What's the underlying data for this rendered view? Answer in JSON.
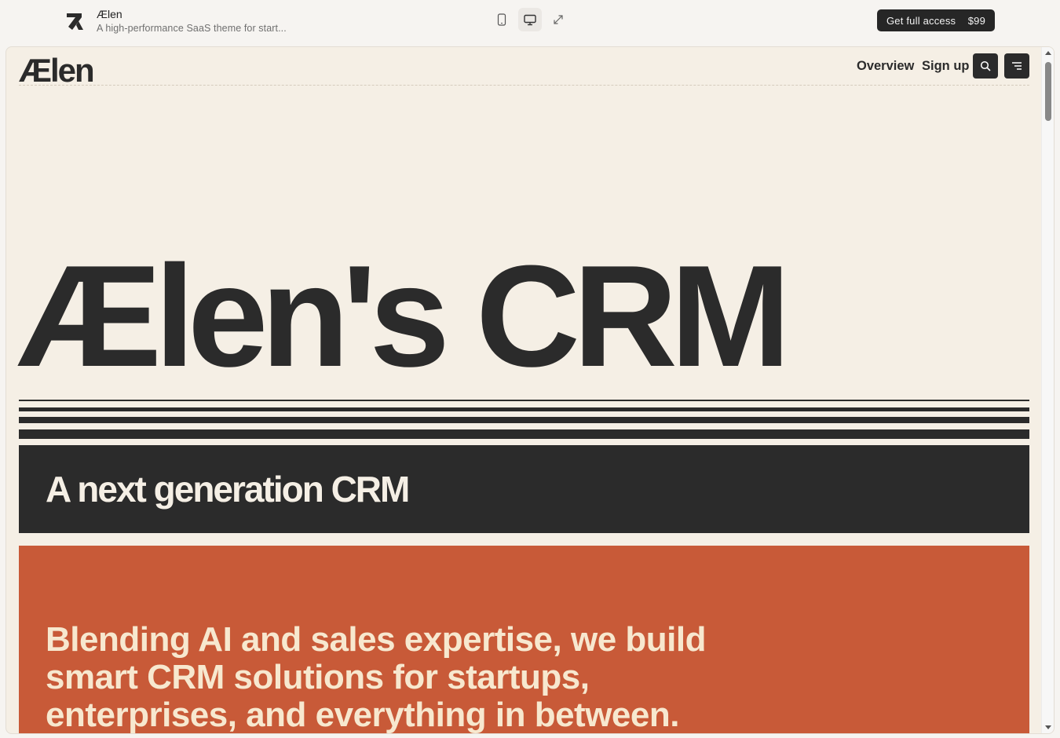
{
  "preview_bar": {
    "title": "Ælen",
    "subtitle": "A high-performance SaaS theme for start...",
    "cta_label": "Get full access",
    "cta_price": "$99",
    "view_modes": [
      "mobile",
      "desktop",
      "fullscreen"
    ],
    "active_view": "desktop"
  },
  "site": {
    "logo_text": "Ælen",
    "nav": {
      "overview": "Overview",
      "signup": "Sign up"
    },
    "hero_title": "Ælen's CRM",
    "band_heading": "A next generation CRM",
    "tagline": "Blending AI and sales expertise, we build smart CRM solutions for startups, enterprises, and everything in between."
  },
  "colors": {
    "page_bg": "#f6f4f1",
    "site_bg": "#f5efe5",
    "ink": "#2b2b2b",
    "accent": "#c85a38",
    "accent_text": "#f7e8cf"
  }
}
